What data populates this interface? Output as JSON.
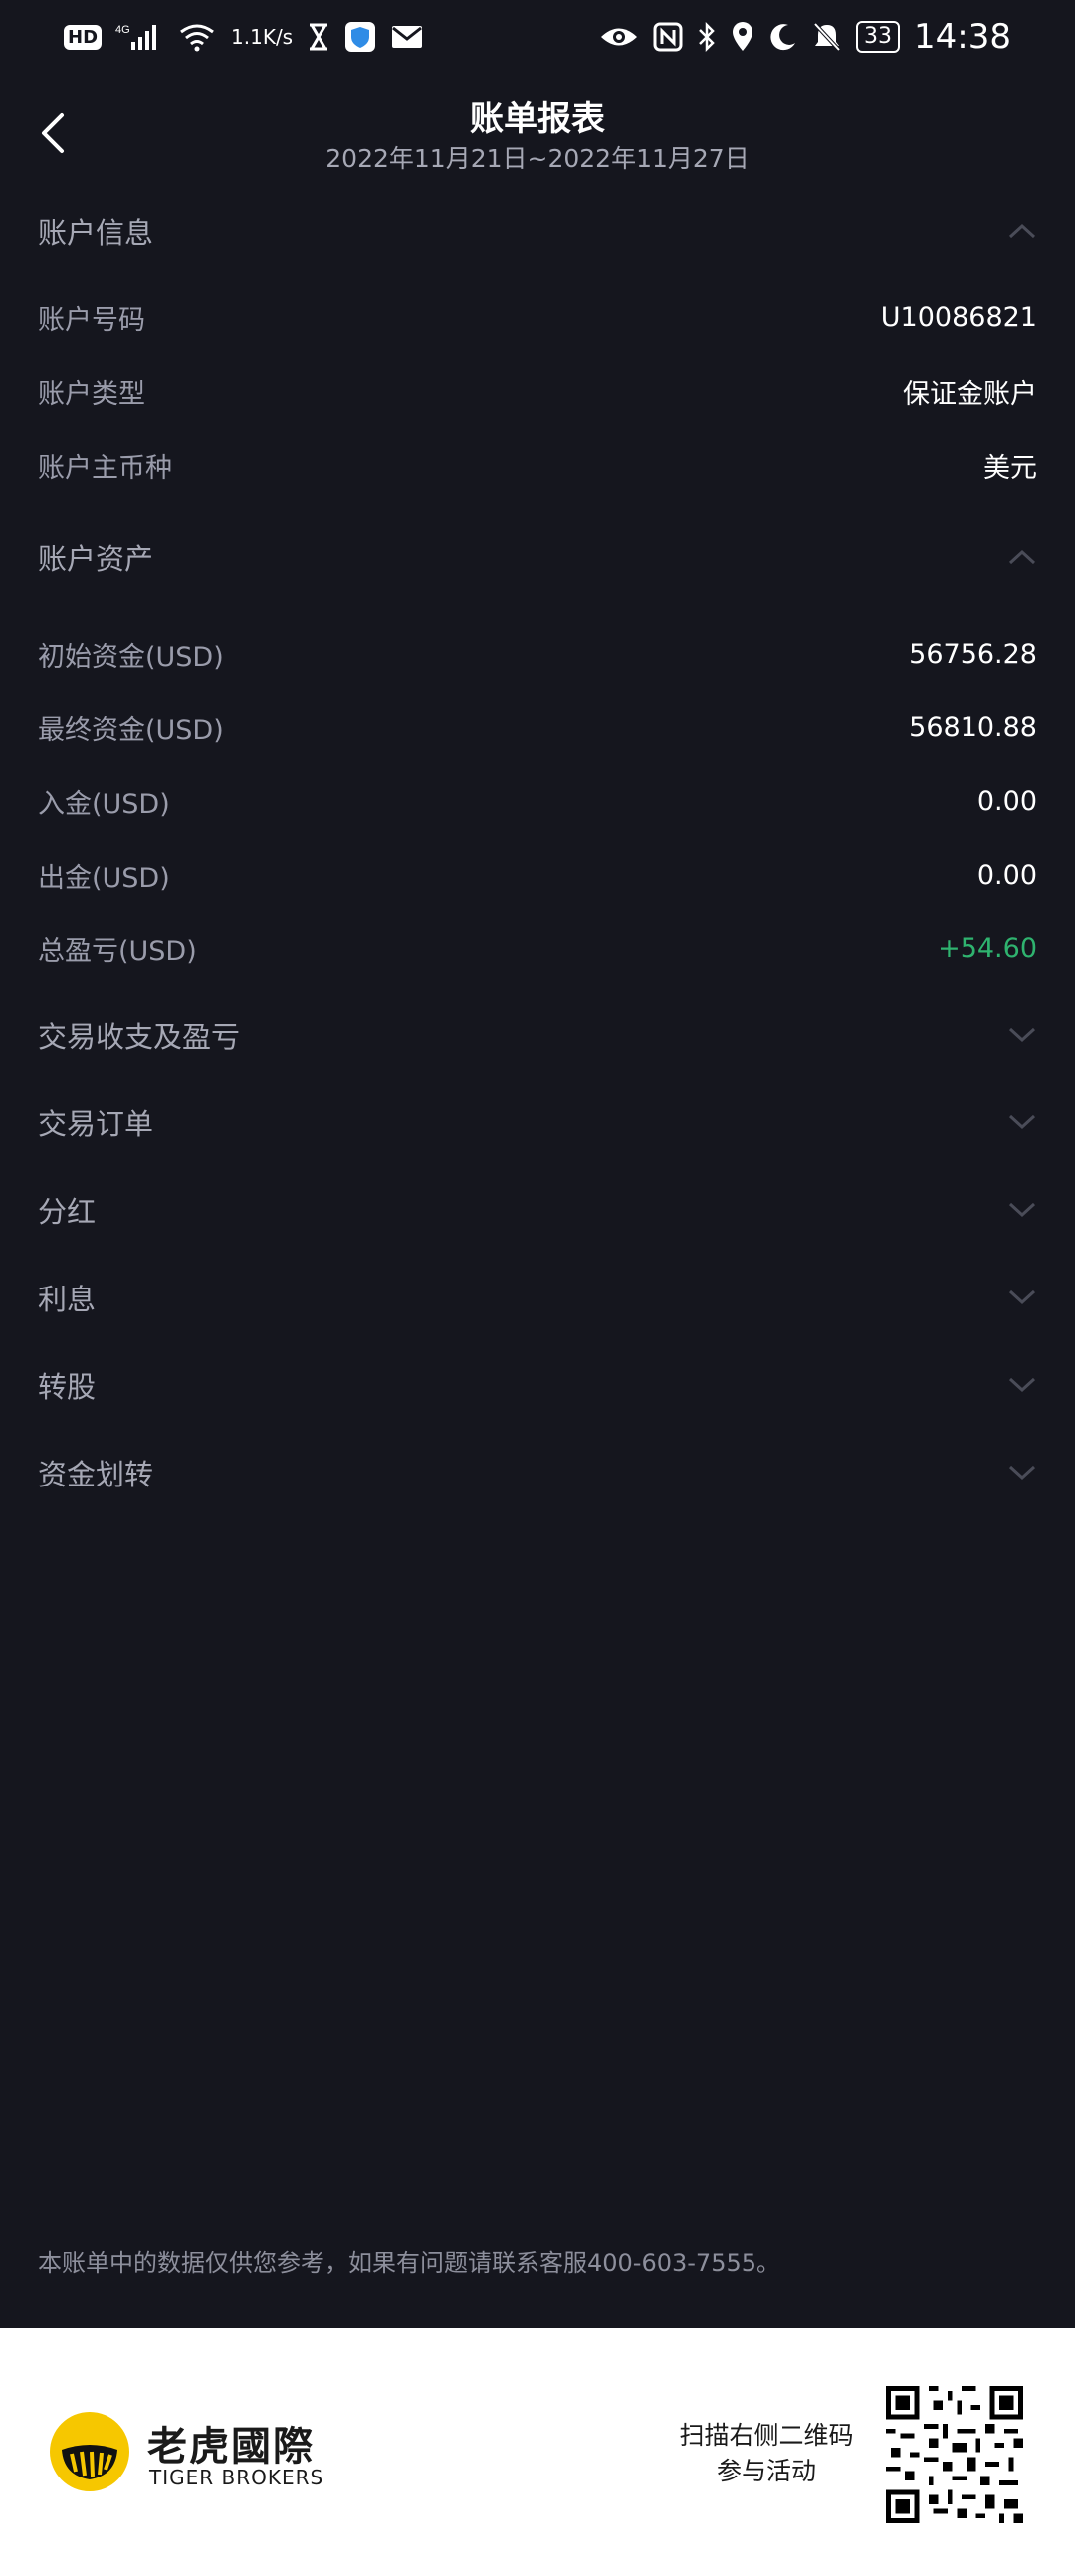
{
  "status_bar": {
    "network_badge": "HD",
    "net_type": "4G",
    "speed_value": "1.1",
    "speed_unit": "K/s",
    "battery": "33",
    "time": "14:38",
    "icons": [
      "hd-icon",
      "signal-icon",
      "wifi-icon",
      "hourglass-icon",
      "shield-icon",
      "mail-icon",
      "eye-icon",
      "nfc-icon",
      "bluetooth-icon",
      "location-icon",
      "moon-icon",
      "mute-icon",
      "battery-icon"
    ]
  },
  "header": {
    "title": "账单报表",
    "date_range": "2022年11月21日~2022年11月27日"
  },
  "account_info": {
    "title": "账户信息",
    "rows": [
      {
        "label": "账户号码",
        "value": "U10086821"
      },
      {
        "label": "账户类型",
        "value": "保证金账户"
      },
      {
        "label": "账户主币种",
        "value": "美元"
      }
    ]
  },
  "account_assets": {
    "title": "账户资产",
    "rows": [
      {
        "label": "初始资金(USD)",
        "value": "56756.28"
      },
      {
        "label": "最终资金(USD)",
        "value": "56810.88"
      },
      {
        "label": "入金(USD)",
        "value": "0.00"
      },
      {
        "label": "出金(USD)",
        "value": "0.00"
      },
      {
        "label": "总盈亏(USD)",
        "value": "+54.60"
      }
    ]
  },
  "collapsed_sections": [
    {
      "title": "交易收支及盈亏"
    },
    {
      "title": "交易订单"
    },
    {
      "title": "分红"
    },
    {
      "title": "利息"
    },
    {
      "title": "转股"
    },
    {
      "title": "资金划转"
    }
  ],
  "disclaimer": "本账单中的数据仅供您参考，如果有问题请联系客服400-603-7555。",
  "footer": {
    "brand_cn": "老虎國際",
    "brand_en": "TIGER BROKERS",
    "scan_line1": "扫描右侧二维码",
    "scan_line2": "参与活动"
  },
  "colors": {
    "background": "#15161e",
    "positive": "#2fb36f",
    "label": "#9a9cab",
    "logo_yellow": "#f6c700"
  }
}
